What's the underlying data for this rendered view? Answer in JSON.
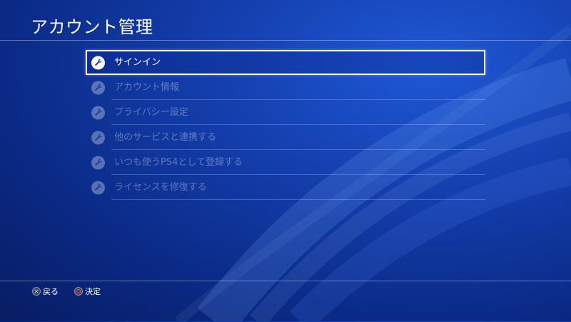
{
  "header": {
    "title": "アカウント管理"
  },
  "menu": {
    "items": [
      {
        "label": "サインイン",
        "icon": "wrench-icon",
        "selected": true,
        "enabled": true
      },
      {
        "label": "アカウント情報",
        "icon": "wrench-icon",
        "selected": false,
        "enabled": false
      },
      {
        "label": "プライバシー設定",
        "icon": "wrench-icon",
        "selected": false,
        "enabled": false
      },
      {
        "label": "他のサービスと連携する",
        "icon": "wrench-icon",
        "selected": false,
        "enabled": false
      },
      {
        "label": "いつも使うPS4として登録する",
        "icon": "wrench-icon",
        "selected": false,
        "enabled": false
      },
      {
        "label": "ライセンスを修復する",
        "icon": "wrench-icon",
        "selected": false,
        "enabled": false
      }
    ]
  },
  "footer": {
    "back_label": "戻る",
    "back_icon": "cross-button-icon",
    "confirm_label": "決定",
    "confirm_icon": "circle-button-icon"
  },
  "colors": {
    "background_dark": "#0b2a86",
    "background_light": "#1f58d6",
    "selection_border": "#ffffff",
    "circle_button_accent": "#e0455a",
    "cross_button_accent": "#8fb3ff"
  }
}
